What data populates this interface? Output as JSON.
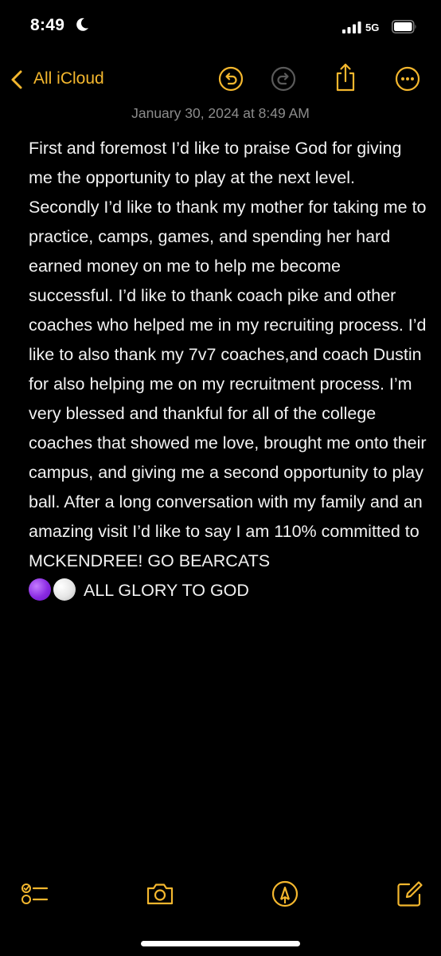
{
  "status_bar": {
    "time": "8:49",
    "network": "5G",
    "icons": [
      "moon-icon",
      "cellular-signal-icon",
      "battery-icon"
    ]
  },
  "nav": {
    "back_label": "All iCloud",
    "icons": [
      "chevron-left-icon",
      "undo-icon",
      "redo-icon",
      "share-icon",
      "more-icon"
    ],
    "accent_color": "#f4b72e"
  },
  "note": {
    "date": "January 30, 2024 at 8:49 AM",
    "body": "First and foremost I’d like to praise God for giving me the opportunity to play at the next level. Secondly I’d like to thank my mother for taking me to practice, camps, games, and spending her hard earned money on me to help me become successful. I’d like to thank coach pike and other coaches who helped me in my recruiting process. I’d like to also thank my 7v7 coaches,and coach Dustin for also helping me on my recruitment process. I’m very blessed and thankful for all of the college coaches that showed me love, brought me onto their campus, and giving me a second opportunity to play ball. After a long conversation with my family and an amazing visit I’d like to say I am 110% committed to MCKENDREE! GO BEARCATS",
    "closing": "ALL GLORY TO GOD",
    "emoji": [
      "purple-circle",
      "white-circle"
    ]
  },
  "toolbar": {
    "icons": [
      "checklist-icon",
      "camera-icon",
      "markup-icon",
      "compose-icon"
    ]
  }
}
